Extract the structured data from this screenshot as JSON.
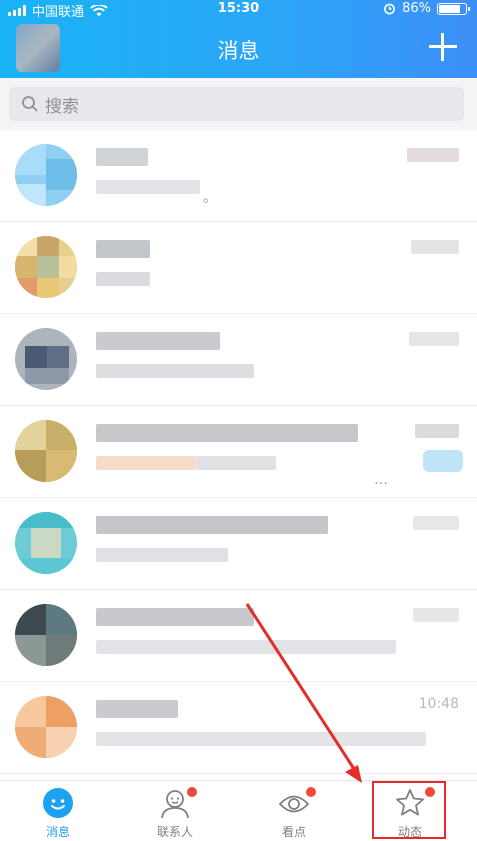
{
  "status_bar": {
    "carrier": "中国联通",
    "time": "15:30",
    "battery": "86%",
    "battery_level": 0.86
  },
  "nav": {
    "title": "消息",
    "add_icon": "plus-icon"
  },
  "search": {
    "placeholder": "搜索"
  },
  "conversations": [
    {
      "ellipsis": "。"
    },
    {},
    {},
    {
      "ellipsis": "…"
    },
    {},
    {},
    {
      "time": "10:48"
    }
  ],
  "tabs": [
    {
      "label": "消息",
      "icon": "chat-bubble-icon",
      "active": true,
      "badge": false
    },
    {
      "label": "联系人",
      "icon": "contacts-icon",
      "active": false,
      "badge": true
    },
    {
      "label": "看点",
      "icon": "eye-icon",
      "active": false,
      "badge": true
    },
    {
      "label": "动态",
      "icon": "star-icon",
      "active": false,
      "badge": true
    }
  ],
  "colors": {
    "header": "#22aaf6",
    "active_tab": "#1ea1f2",
    "badge": "#f24a3a",
    "annotation": "#e62b2b"
  }
}
